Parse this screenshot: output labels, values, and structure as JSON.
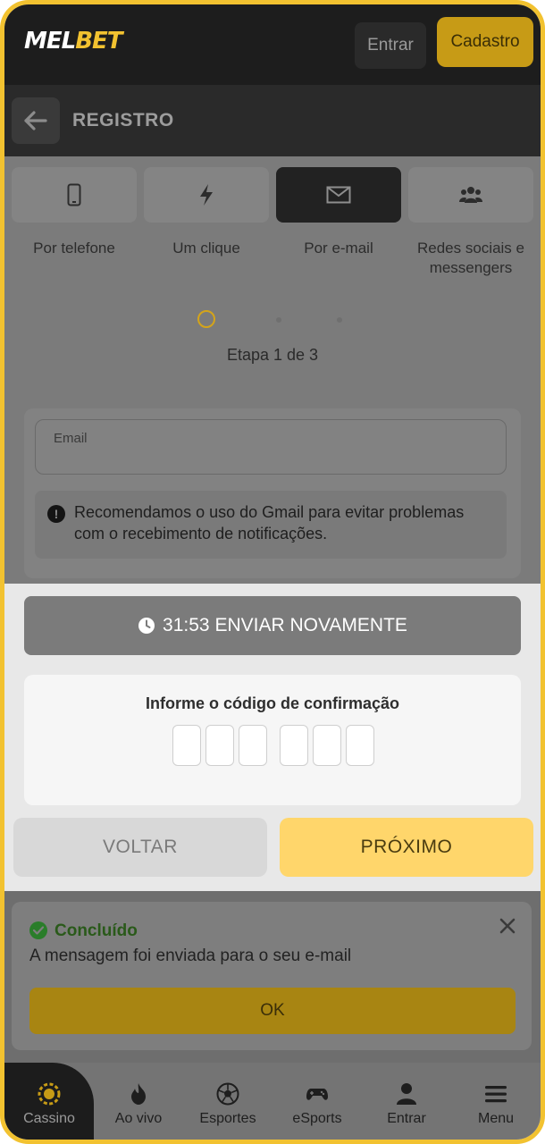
{
  "header": {
    "logo_main": "MEL",
    "logo_accent": "BET",
    "login_label": "Entrar",
    "register_label": "Cadastro"
  },
  "subheader": {
    "title": "REGISTRO"
  },
  "tabs": [
    {
      "label": "Por telefone",
      "icon": "phone-icon"
    },
    {
      "label": "Um clique",
      "icon": "lightning-icon"
    },
    {
      "label": "Por e-mail",
      "icon": "envelope-icon",
      "active": true
    },
    {
      "label": "Redes sociais e messengers",
      "icon": "people-icon"
    }
  ],
  "steps": {
    "text": "Etapa 1 de 3",
    "current": 1,
    "total": 3
  },
  "form": {
    "email_label": "Email",
    "notice": "Recomendamos o uso do Gmail para evitar problemas com o recebimento de notificações."
  },
  "verification": {
    "resend_timer": "31:53",
    "resend_label": "ENVIAR NOVAMENTE",
    "code_title": "Informe o código de confirmação",
    "code_length": 6
  },
  "actions": {
    "back_label": "VOLTAR",
    "next_label": "PRÓXIMO"
  },
  "toast": {
    "title": "Concluído",
    "message": "A mensagem foi enviada para o seu e-mail",
    "ok_label": "OK"
  },
  "bottom_nav": [
    {
      "label": "Cassino",
      "icon": "casino-chip-icon",
      "active": true
    },
    {
      "label": "Ao vivo",
      "icon": "fire-icon"
    },
    {
      "label": "Esportes",
      "icon": "soccer-ball-icon"
    },
    {
      "label": "eSports",
      "icon": "gamepad-icon"
    },
    {
      "label": "Entrar",
      "icon": "user-icon"
    },
    {
      "label": "Menu",
      "icon": "hamburger-icon"
    }
  ],
  "colors": {
    "brand_yellow": "#f2c230",
    "next_button": "#ffd66b",
    "success_green": "#2a7d2a"
  }
}
